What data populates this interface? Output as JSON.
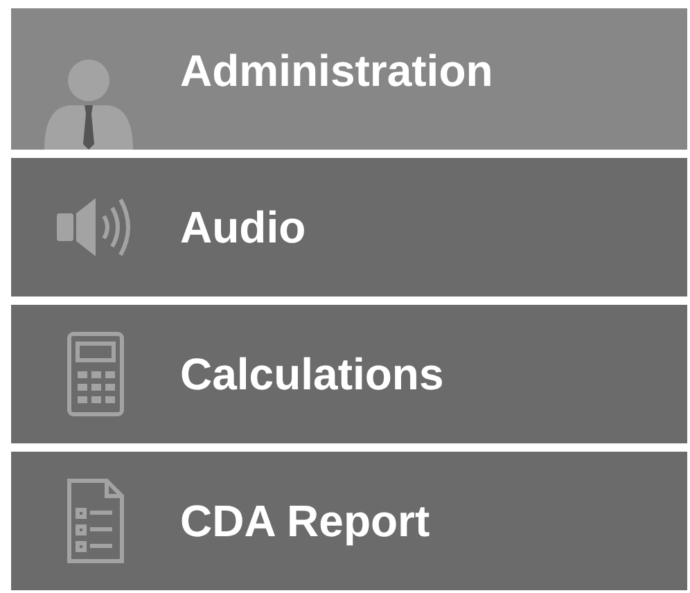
{
  "menu": [
    {
      "label": "Administration",
      "kind": "person",
      "selected": true
    },
    {
      "label": "Audio",
      "kind": "speaker",
      "selected": false
    },
    {
      "label": "Calculations",
      "kind": "calculator",
      "selected": false
    },
    {
      "label": "CDA Report",
      "kind": "document",
      "selected": false
    }
  ]
}
